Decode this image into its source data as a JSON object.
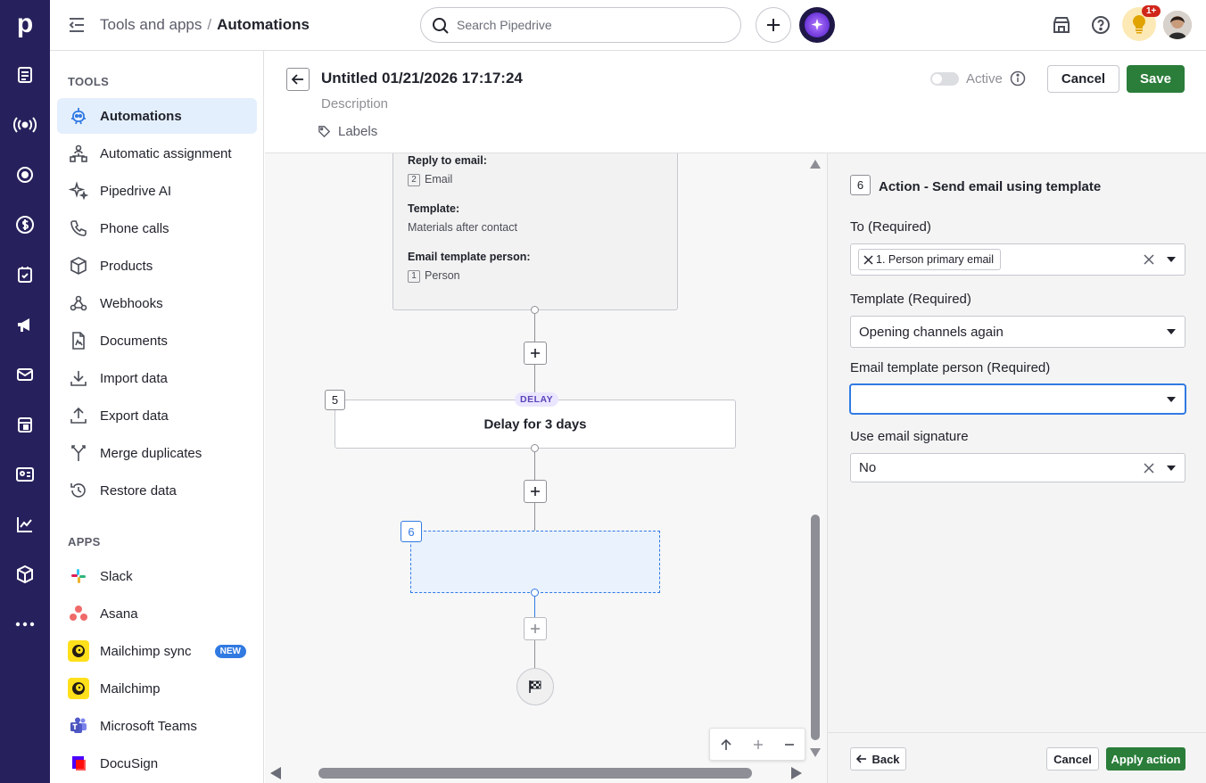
{
  "topbar": {
    "breadcrumb_parent": "Tools and apps",
    "breadcrumb_separator": "/",
    "breadcrumb_current": "Automations",
    "search_placeholder": "Search Pipedrive",
    "notification_badge": "1+"
  },
  "rail": {
    "logo": "p",
    "icons": [
      "leads-icon",
      "deals-radar-icon",
      "target-icon",
      "dollar-icon",
      "activities-icon",
      "campaigns-icon",
      "mail-icon",
      "calendar-icon",
      "contacts-icon",
      "insights-icon",
      "products-icon",
      "more-icon"
    ]
  },
  "sidebar": {
    "tools_title": "TOOLS",
    "tools": [
      {
        "label": "Automations",
        "icon": "robot-icon",
        "active": true
      },
      {
        "label": "Automatic assignment",
        "icon": "assignment-icon"
      },
      {
        "label": "Pipedrive AI",
        "icon": "sparkle-icon"
      },
      {
        "label": "Phone calls",
        "icon": "phone-icon"
      },
      {
        "label": "Products",
        "icon": "box-icon"
      },
      {
        "label": "Webhooks",
        "icon": "webhook-icon"
      },
      {
        "label": "Documents",
        "icon": "document-icon"
      },
      {
        "label": "Import data",
        "icon": "import-icon"
      },
      {
        "label": "Export data",
        "icon": "export-icon"
      },
      {
        "label": "Merge duplicates",
        "icon": "merge-icon"
      },
      {
        "label": "Restore data",
        "icon": "restore-icon"
      }
    ],
    "apps_title": "APPS",
    "apps": [
      {
        "label": "Slack",
        "icon": "slack-icon"
      },
      {
        "label": "Asana",
        "icon": "asana-icon"
      },
      {
        "label": "Mailchimp sync",
        "icon": "mailchimp-icon",
        "badge": "NEW"
      },
      {
        "label": "Mailchimp",
        "icon": "mailchimp-icon"
      },
      {
        "label": "Microsoft Teams",
        "icon": "teams-icon"
      },
      {
        "label": "DocuSign",
        "icon": "docusign-icon"
      }
    ]
  },
  "header": {
    "title": "Untitled 01/21/2026 17:17:24",
    "description_placeholder": "Description",
    "labels_label": "Labels",
    "active_label": "Active",
    "cancel_label": "Cancel",
    "save_label": "Save"
  },
  "canvas": {
    "email_node": {
      "reply_label": "Reply to email:",
      "reply_tag": "2",
      "reply_value": "Email",
      "template_label": "Template:",
      "template_value": "Materials after contact",
      "person_label": "Email template person:",
      "person_tag": "1",
      "person_value": "Person"
    },
    "delay_node": {
      "step": "5",
      "badge": "DELAY",
      "text": "Delay for 3 days"
    },
    "new_node_step": "6",
    "add_step": "+"
  },
  "panel": {
    "step": "6",
    "title": "Action - Send email using template",
    "to_label": "To (Required)",
    "to_chip": "1. Person primary email",
    "template_label": "Template (Required)",
    "template_value": "Opening channels again",
    "person_label": "Email template person (Required)",
    "person_value": "",
    "signature_label": "Use email signature",
    "signature_value": "No",
    "back_label": "Back",
    "cancel_label": "Cancel",
    "apply_label": "Apply action"
  },
  "colors": {
    "rail_bg": "#26215c",
    "save_green": "#2b7d3a",
    "active_item_bg": "#e4effd",
    "focus_blue": "#317ae2"
  }
}
